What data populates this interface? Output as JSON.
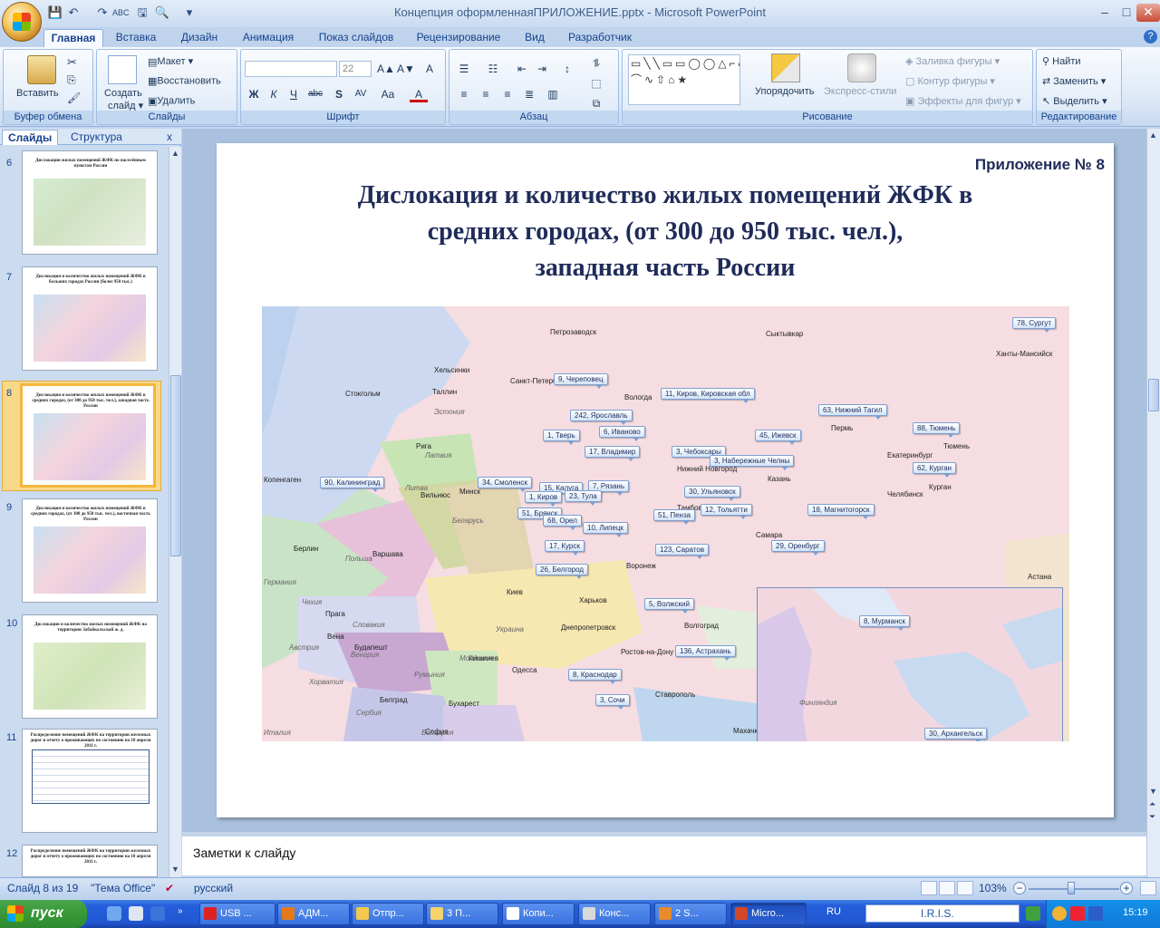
{
  "window": {
    "title": "Концепция оформленнаяПРИЛОЖЕНИЕ.pptx - Microsoft PowerPoint",
    "min": "–",
    "max": "□",
    "close": "✕"
  },
  "qat": [
    "💾",
    "↶",
    "↷",
    "ABC",
    "🖫",
    "🔍",
    "▾"
  ],
  "tabs": [
    "Главная",
    "Вставка",
    "Дизайн",
    "Анимация",
    "Показ слайдов",
    "Рецензирование",
    "Вид",
    "Разработчик"
  ],
  "help": "?",
  "ribbon": {
    "clipboard": {
      "label": "Буфер обмена",
      "paste": "Вставить"
    },
    "slides": {
      "label": "Слайды",
      "create": "Создать",
      "create2": "слайд ▾",
      "layout": "Макет ▾",
      "reset": "Восстановить",
      "delete": "Удалить"
    },
    "font": {
      "label": "Шрифт",
      "size": "22",
      "bold": "Ж",
      "italic": "К",
      "underline": "Ч",
      "strike": "abc",
      "shadow": "S",
      "spacing": "AV",
      "case": "Aa",
      "color": "A",
      "grow": "A▲",
      "shrink": "A▼",
      "clear": "A"
    },
    "paragraph": {
      "label": "Абзац"
    },
    "drawing": {
      "label": "Рисование",
      "arrange": "Упорядочить",
      "quickstyles": "Экспресс-стили",
      "fill": "Заливка фигуры ▾",
      "outline": "Контур фигуры ▾",
      "effects": "Эффекты для фигур ▾",
      "shapes": "▭╲╲▭▭◯◯△⌐⌐⇨⇩☆{}⌒∿⇧⌂★"
    },
    "editing": {
      "label": "Редактирование",
      "find": "Найти",
      "replace": "Заменить ▾",
      "select": "Выделить ▾"
    }
  },
  "pane": {
    "tab_slides": "Слайды",
    "tab_outline": "Структура",
    "close": "x",
    "thumbs": [
      {
        "num": "6",
        "title": "Дислокация жилых помещений ЖФК по населённым пунктам России"
      },
      {
        "num": "7",
        "title": "Дислокация и количество жилых помещений ЖФК в больших городах России (более 950 тыс.)"
      },
      {
        "num": "8",
        "title": "Дислокация и количество жилых помещений ЖФК в средних городах, (от 300 до 950 тыс. чел.), западная часть России"
      },
      {
        "num": "9",
        "title": "Дислокация и количество жилых помещений ЖФК в средних городах, (от 300 до 950 тыс. чел.), восточная часть России"
      },
      {
        "num": "10",
        "title": "Дислокация и количество жилых помещений ЖФК на территории Забайкальской ж. д."
      },
      {
        "num": "11",
        "title": "Распределение помещений ЖФК на территории железных дорог и отчету о проживающих по состоянию на 18 апреля 2011 г."
      },
      {
        "num": "12",
        "title": "Распределение помещений ЖФК на территории железных дорог и отчету о проживающих по состоянию на 18 апреля 2011 г."
      }
    ]
  },
  "slide": {
    "appendix": "Приложение № 8",
    "title_l1": "Дислокация и количество жилых помещений ЖФК в",
    "title_l2": "средних городах, (от 300 до 950 тыс. чел.),",
    "title_l3": "западная часть России",
    "callouts": [
      "78, Сургут",
      "9, Череповец",
      "11, Киров, Кировская обл",
      "242, Ярославль",
      "6, Иваново",
      "63, Нижний Тагил",
      "1, Тверь",
      "17, Владимир",
      "3, Чебоксары",
      "45, Ижевск",
      "88, Тюмень",
      "3, Набережные Челны",
      "62, Курган",
      "90, Калининград",
      "34, Смоленск",
      "15, Калуга",
      "7, Рязань",
      "23, Тула",
      "1, Киров",
      "30, Ульяновск",
      "51, Брянск",
      "68, Орел",
      "12, Тольятти",
      "18, Магнитогорск",
      "51, Пенза",
      "10, Липецк",
      "17, Курск",
      "123, Саратов",
      "29, Оренбург",
      "26, Белгород",
      "5, Волжский",
      "136, Астрахань",
      "8, Краснодар",
      "3, Сочи"
    ],
    "inset_callouts": [
      "8, Мурманск",
      "30, Архангельск"
    ],
    "places": [
      "Хельсинки",
      "Стокгольм",
      "Таллин",
      "Рига",
      "Вильнюс",
      "Копенгаген",
      "Берлин",
      "Варшава",
      "Прага",
      "Вена",
      "Будапешт",
      "Белград",
      "Бухарест",
      "София",
      "Киев",
      "Минск",
      "Кишинев",
      "Астана",
      "Санкт-Петербург",
      "Петрозаводск",
      "Вологда",
      "Сыктывкар",
      "Ханты-Мансийск",
      "Пермь",
      "Екатеринбург",
      "Челябинск",
      "Казань",
      "Самара",
      "Волгоград",
      "Ростов-на-Дону",
      "Ставрополь",
      "Махачкала",
      "Харьков",
      "Днепропетровск",
      "Одесса",
      "Воронеж",
      "Тамбов",
      "Нижний Новгород",
      "Тюмень",
      "Курган"
    ],
    "countries": [
      "Латвия",
      "Литва",
      "Эстония",
      "Беларусь",
      "Польша",
      "Украина",
      "Чехия",
      "Словакия",
      "Австрия",
      "Венгрия",
      "Румыния",
      "Молдавия",
      "Хорватия",
      "Сербия",
      "Болгария",
      "Италия",
      "Германия",
      "Финляндия"
    ]
  },
  "notes": "Заметки к слайду",
  "status": {
    "slide": "Слайд 8 из 19",
    "theme": "\"Тема Office\"",
    "lang": "русский",
    "zoom": "103%"
  },
  "taskbar": {
    "start": "пуск",
    "tasks": [
      "USB ...",
      "АДМ...",
      "Отпр...",
      "3 П...",
      "Копи...",
      "Конс...",
      "2 S...",
      "Micro..."
    ],
    "lang": "RU",
    "iris": "I.R.I.S.",
    "time": "15:19"
  },
  "colors": {
    "ribbon": "#dbe7f6",
    "accent": "#15428b",
    "selected_thumb": "#f4b63d",
    "callout": "#d4e3f7"
  }
}
